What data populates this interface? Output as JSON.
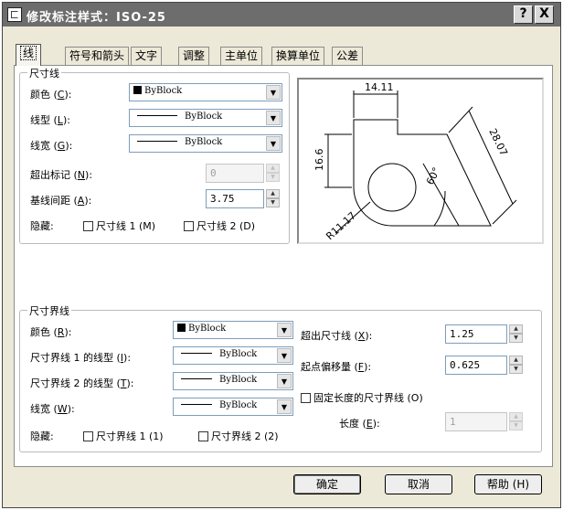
{
  "window": {
    "title": "修改标注样式：ISO-25",
    "help_btn": "?",
    "close_btn": "X"
  },
  "tabs": [
    {
      "label": "线"
    },
    {
      "label": "符号和箭头"
    },
    {
      "label": "文字"
    },
    {
      "label": "调整"
    },
    {
      "label": "主单位"
    },
    {
      "label": "换算单位"
    },
    {
      "label": "公差"
    }
  ],
  "dim_lines": {
    "group_title": "尺寸线",
    "color": {
      "label_main": "颜色 (",
      "label_key": "C",
      "label_end": "):",
      "value": "ByBlock"
    },
    "linetype": {
      "label_main": "线型 (",
      "label_key": "L",
      "label_end": "):",
      "value": "ByBlock"
    },
    "lineweight": {
      "label_main": "线宽 (",
      "label_key": "G",
      "label_end": "):",
      "value": "ByBlock"
    },
    "extend_ticks": {
      "label_main": "超出标记 (",
      "label_key": "N",
      "label_end": "):",
      "value": "0"
    },
    "baseline_spacing": {
      "label_main": "基线间距 (",
      "label_key": "A",
      "label_end": "):",
      "value": "3.75"
    },
    "suppress": {
      "label": "隐藏:",
      "dim1": "尺寸线 1 (M)",
      "dim2": "尺寸线 2 (D)"
    }
  },
  "ext_lines": {
    "group_title": "尺寸界线",
    "color": {
      "label_main": "颜色 (",
      "label_key": "R",
      "label_end": "):",
      "value": "ByBlock"
    },
    "linetype1": {
      "label_main": "尺寸界线 1 的线型 (",
      "label_key": "I",
      "label_end": "):",
      "value": "ByBlock"
    },
    "linetype2": {
      "label_main": "尺寸界线 2 的线型 (",
      "label_key": "T",
      "label_end": "):",
      "value": "ByBlock"
    },
    "lineweight": {
      "label_main": "线宽 (",
      "label_key": "W",
      "label_end": "):",
      "value": "ByBlock"
    },
    "suppress": {
      "label": "隐藏:",
      "ext1": "尺寸界线 1 (1)",
      "ext2": "尺寸界线 2 (2)"
    },
    "extend_beyond": {
      "label_main": "超出尺寸线 (",
      "label_key": "X",
      "label_end": "):",
      "value": "1.25"
    },
    "offset": {
      "label_main": "起点偏移量 (",
      "label_key": "F",
      "label_end": "):",
      "value": "0.625"
    },
    "fixed_length": {
      "label": "固定长度的尺寸界线 (O)"
    },
    "length": {
      "label_main": "长度 (",
      "label_key": "E",
      "label_end": "):",
      "value": "1"
    }
  },
  "preview": {
    "dim_top": "14.11",
    "dim_left": "16.6",
    "dim_slant": "28.07",
    "dim_angle": "60°",
    "dim_radius": "R11.17"
  },
  "buttons": {
    "ok": "确定",
    "cancel": "取消",
    "help": "帮助 (H)"
  },
  "colors": {
    "titlebar": "#6d6d6d",
    "dialog_bg": "#ece9d8",
    "panel_bg": "#ffffff",
    "input_border": "#7f9db9"
  }
}
